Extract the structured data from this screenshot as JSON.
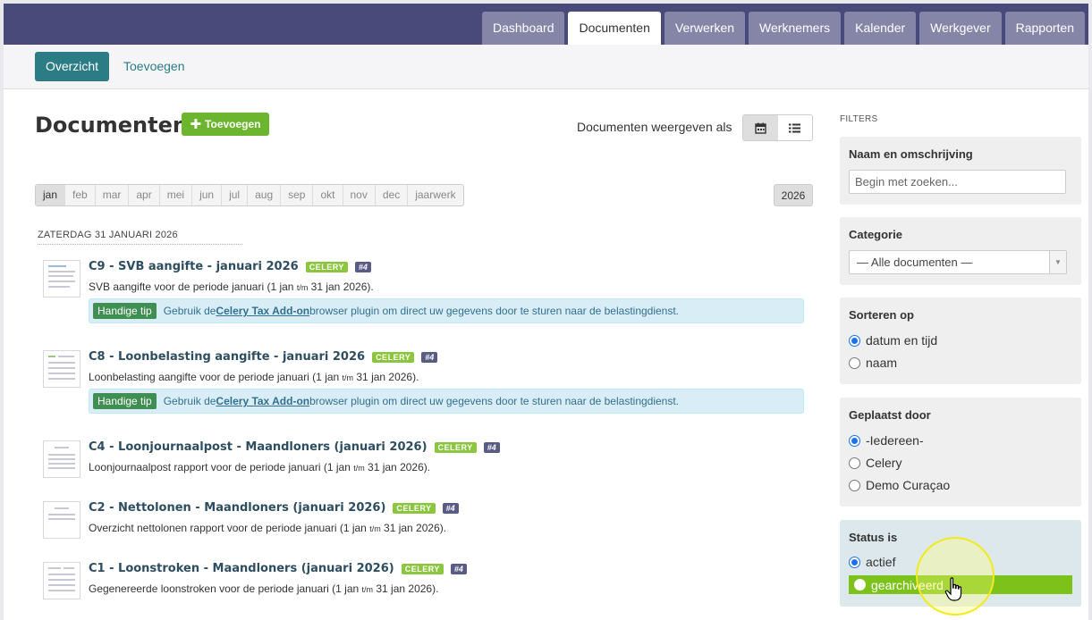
{
  "nav": {
    "tabs": [
      {
        "label": "Dashboard",
        "active": false
      },
      {
        "label": "Documenten",
        "active": true
      },
      {
        "label": "Verwerken",
        "active": false
      },
      {
        "label": "Werknemers",
        "active": false
      },
      {
        "label": "Kalender",
        "active": false
      },
      {
        "label": "Werkgever",
        "active": false
      },
      {
        "label": "Rapporten",
        "active": false
      }
    ]
  },
  "subnav": {
    "overview_label": "Overzicht",
    "add_label": "Toevoegen"
  },
  "main": {
    "title": "Documenten",
    "add_button_label": "Toevoegen",
    "view_label": "Documenten weergeven als",
    "view_modes": [
      "calendar-icon",
      "list-icon"
    ],
    "months": [
      "jan",
      "feb",
      "mar",
      "apr",
      "mei",
      "jun",
      "jul",
      "aug",
      "sep",
      "okt",
      "nov",
      "dec",
      "jaarwerk"
    ],
    "active_month": "jan",
    "year": "2026",
    "date_heading": "ZATERDAG 31 JANUARI 2026",
    "documents": [
      {
        "title": "C9 - SVB aangifte - januari 2026",
        "badge": "CELERY",
        "number": "#4",
        "desc_before": "SVB aangifte voor de periode januari (1 jan ",
        "desc_small": "t/m",
        "desc_after": " 31 jan 2026).",
        "has_tip": true
      },
      {
        "title": "C8 - Loonbelasting aangifte - januari 2026",
        "badge": "CELERY",
        "number": "#4",
        "desc_before": "Loonbelasting aangifte voor de periode januari (1 jan ",
        "desc_small": "t/m",
        "desc_after": " 31 jan 2026).",
        "has_tip": true
      },
      {
        "title": "C4 - Loonjournaalpost - Maandloners (januari 2026)",
        "badge": "CELERY",
        "number": "#4",
        "desc_before": "Loonjournaalpost rapport voor de periode januari (1 jan ",
        "desc_small": "t/m",
        "desc_after": " 31 jan 2026).",
        "has_tip": false
      },
      {
        "title": "C2 - Nettolonen - Maandloners (januari 2026)",
        "badge": "CELERY",
        "number": "#4",
        "desc_before": "Overzicht nettolonen rapport voor de periode januari (1 jan ",
        "desc_small": "t/m",
        "desc_after": " 31 jan 2026).",
        "has_tip": false
      },
      {
        "title": "C1 - Loonstroken - Maandloners (januari 2026)",
        "badge": "CELERY",
        "number": "#4",
        "desc_before": "Gegenereerde loonstroken voor de periode januari (1 jan ",
        "desc_small": "t/m",
        "desc_after": " 31 jan 2026).",
        "has_tip": false
      }
    ],
    "tip": {
      "label": "Handige tip",
      "before": "Gebruik de ",
      "link": "Celery Tax Add-on",
      "after": " browser plugin om direct uw gegevens door te sturen naar de belastingdienst."
    }
  },
  "filters": {
    "title": "FILTERS",
    "name": {
      "heading": "Naam en omschrijving",
      "placeholder": "Begin met zoeken..."
    },
    "category": {
      "heading": "Categorie",
      "selected": "— Alle documenten —"
    },
    "sort": {
      "heading": "Sorteren op",
      "options": [
        {
          "label": "datum en tijd",
          "checked": true
        },
        {
          "label": "naam",
          "checked": false
        }
      ]
    },
    "placed_by": {
      "heading": "Geplaatst door",
      "options": [
        {
          "label": "-Iedereen-",
          "checked": true
        },
        {
          "label": "Celery",
          "checked": false
        },
        {
          "label": "Demo Curaçao",
          "checked": false
        }
      ]
    },
    "status": {
      "heading": "Status is",
      "options": [
        {
          "label": "actief",
          "checked": true
        },
        {
          "label": "gearchiveerd",
          "checked": false
        }
      ]
    }
  },
  "colors": {
    "topbar": "#4a4a7a",
    "accent_teal": "#2b7c85",
    "celery_green": "#8cc63f",
    "highlight_green": "#7cc21a"
  }
}
